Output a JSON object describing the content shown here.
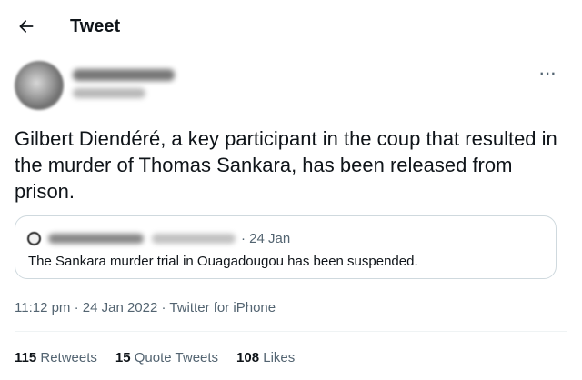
{
  "header": {
    "title": "Tweet",
    "back_icon": "arrow-left-icon"
  },
  "tweet": {
    "more_icon": "more-horizontal-icon",
    "more_label": "···",
    "text": "Gilbert Diendéré, a key participant in the coup that resulted in the murder of Thomas Sankara, has been released from prison.",
    "meta": "11:12 pm · 24 Jan 2022 · Twitter for iPhone"
  },
  "quote": {
    "date": "· 24 Jan",
    "text": "The Sankara murder trial in Ouagadougou has been suspended."
  },
  "stats": [
    {
      "count": "115",
      "label": "Retweets"
    },
    {
      "count": "15",
      "label": "Quote Tweets"
    },
    {
      "count": "108",
      "label": "Likes"
    }
  ],
  "colors": {
    "text_primary": "#0f1419",
    "text_secondary": "#536471",
    "border": "#cfd9de"
  }
}
